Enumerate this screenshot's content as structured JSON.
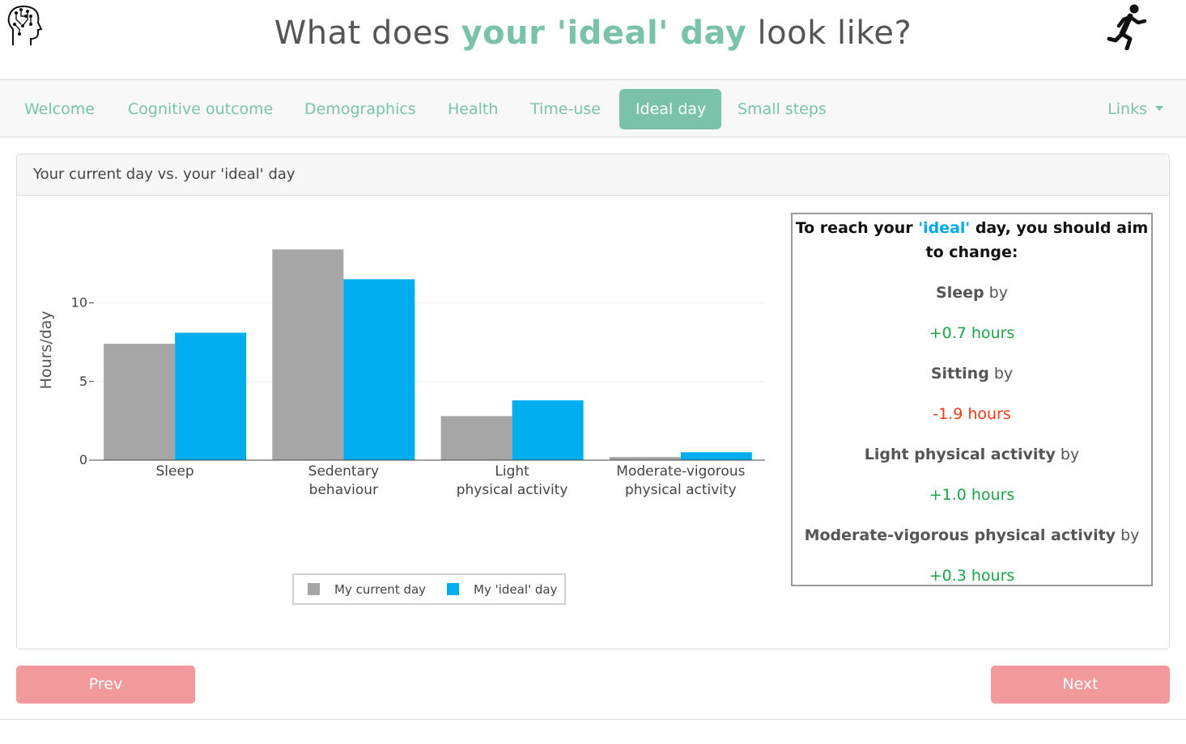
{
  "header": {
    "title_part1": "What does ",
    "title_accent": "your 'ideal' day",
    "title_part2": " look like?",
    "left_icon": "brain-circuit-icon",
    "right_icon": "running-person-icon"
  },
  "nav": {
    "items": [
      {
        "label": "Welcome",
        "active": false
      },
      {
        "label": "Cognitive outcome",
        "active": false
      },
      {
        "label": "Demographics",
        "active": false
      },
      {
        "label": "Health",
        "active": false
      },
      {
        "label": "Time-use",
        "active": false
      },
      {
        "label": "Ideal day",
        "active": true
      },
      {
        "label": "Small steps",
        "active": false
      }
    ],
    "links_label": "Links"
  },
  "card": {
    "title": "Your current day vs. your 'ideal' day"
  },
  "chart_data": {
    "type": "bar",
    "categories": [
      "Sleep",
      "Sedentary\nbehaviour",
      "Light\nphysical activity",
      "Moderate-vigorous\nphysical activity"
    ],
    "series": [
      {
        "name": "My current day",
        "color": "#a6a6a6",
        "values": [
          7.4,
          13.4,
          2.8,
          0.2
        ]
      },
      {
        "name": "My 'ideal' day",
        "color": "#00aeef",
        "values": [
          8.1,
          11.5,
          3.8,
          0.5
        ]
      }
    ],
    "ylabel": "Hours/day",
    "yticks": [
      0,
      5,
      10
    ],
    "ylim": [
      0,
      14.2
    ],
    "legend_position": "bottom-center"
  },
  "summary": {
    "heading_part1": "To reach your ",
    "heading_ideal": "'ideal'",
    "heading_part2": " day, you should aim to change:",
    "by_word": "by",
    "items": [
      {
        "label": "Sleep",
        "value": "+0.7 hours",
        "direction": "positive"
      },
      {
        "label": "Sitting",
        "value": "-1.9 hours",
        "direction": "negative"
      },
      {
        "label": "Light physical activity",
        "value": "+1.0 hours",
        "direction": "positive"
      },
      {
        "label": "Moderate-vigorous physical activity",
        "value": "+0.3 hours",
        "direction": "positive"
      }
    ],
    "colors": {
      "positive": "#1ba34a",
      "negative": "#f03a1a",
      "ideal": "#00a9e8"
    }
  },
  "buttons": {
    "prev": "Prev",
    "next": "Next",
    "color": "#f1999b"
  },
  "theme": {
    "accent": "#7ac3aa"
  }
}
